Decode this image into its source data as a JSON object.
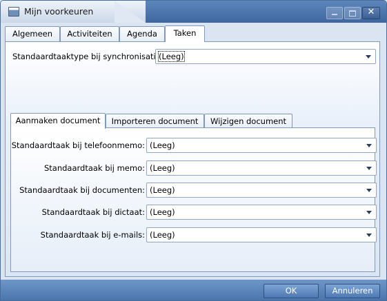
{
  "window": {
    "title": "Mijn voorkeuren",
    "controls": {
      "minimize": "minimize-icon",
      "maximize": "maximize-icon",
      "close": "✕"
    }
  },
  "tabs": [
    {
      "label": "Algemeen"
    },
    {
      "label": "Activiteiten"
    },
    {
      "label": "Agenda"
    },
    {
      "label": "Taken",
      "active": true
    }
  ],
  "sync": {
    "label": "Standaardtaaktype bij synchronisatie:",
    "value": "(Leeg)"
  },
  "subtabs": [
    {
      "label": "Aanmaken document",
      "active": true
    },
    {
      "label": "Importeren document"
    },
    {
      "label": "Wijzigen document"
    }
  ],
  "fields": [
    {
      "label": "Standaardtaak bij telefoonmemo:",
      "value": "(Leeg)"
    },
    {
      "label": "Standaardtaak bij memo:",
      "value": "(Leeg)"
    },
    {
      "label": "Standaardtaak bij documenten:",
      "value": "(Leeg)"
    },
    {
      "label": "Standaardtaak bij dictaat:",
      "value": "(Leeg)"
    },
    {
      "label": "Standaardtaak bij e-mails:",
      "value": "(Leeg)"
    }
  ],
  "buttons": {
    "ok": "OK",
    "cancel": "Annuleren"
  },
  "colors": {
    "titlebar": "#4a72aa",
    "accent": "#5a85bd",
    "panel": "#e9f0fa"
  }
}
